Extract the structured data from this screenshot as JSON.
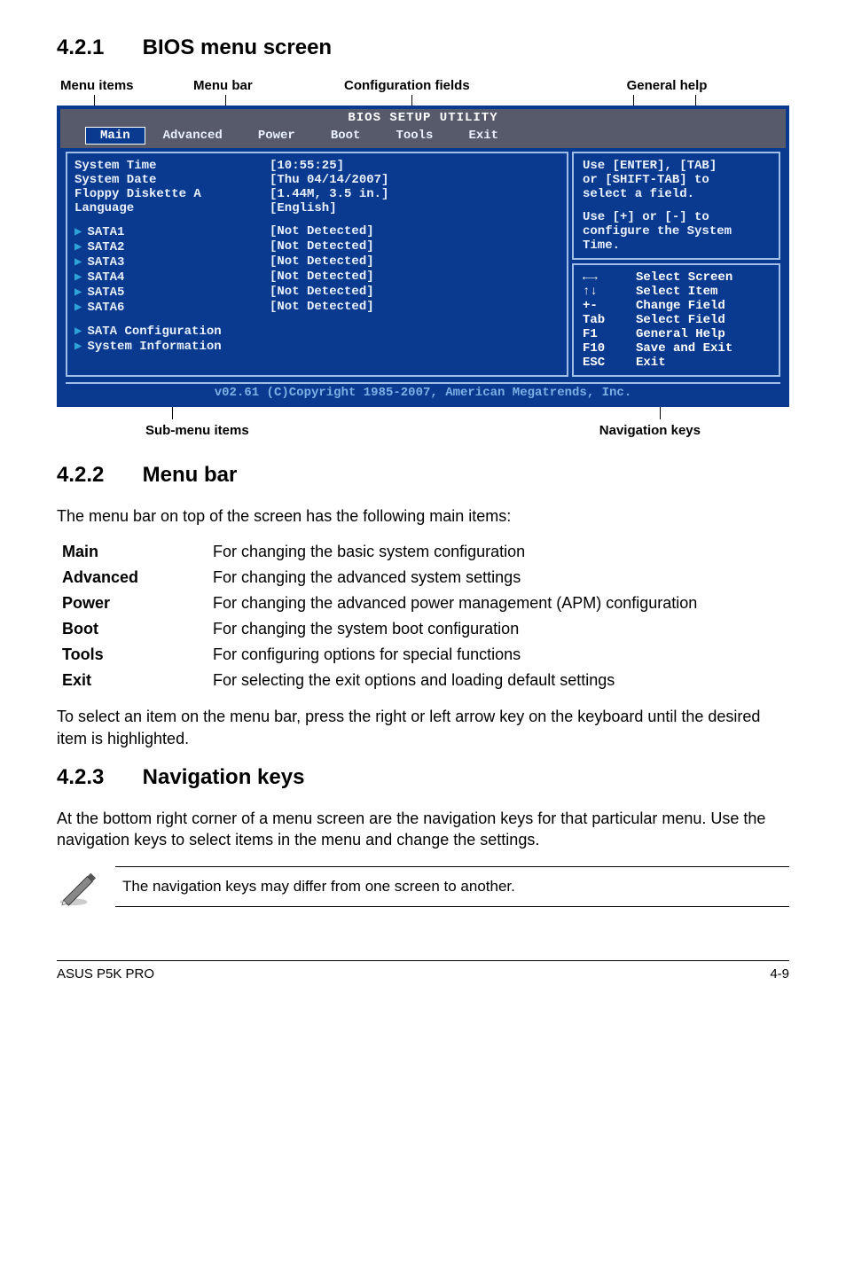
{
  "sections": {
    "s1": {
      "num": "4.2.1",
      "title": "BIOS menu screen"
    },
    "s2": {
      "num": "4.2.2",
      "title": "Menu bar"
    },
    "s3": {
      "num": "4.2.3",
      "title": "Navigation keys"
    }
  },
  "callouts": {
    "menu_items": "Menu items",
    "menu_bar": "Menu bar",
    "config_fields": "Configuration fields",
    "general_help": "General help",
    "sub_menu": "Sub-menu items",
    "nav_keys": "Navigation keys"
  },
  "bios": {
    "title": "BIOS SETUP UTILITY",
    "menubar": [
      "Main",
      "Advanced",
      "Power",
      "Boot",
      "Tools",
      "Exit"
    ],
    "rows": [
      {
        "label": "System Time",
        "value": "[10:55:25]"
      },
      {
        "label": "System Date",
        "value": "[Thu 04/14/2007]"
      },
      {
        "label": "Floppy Diskette A",
        "value": "[1.44M, 3.5 in.]"
      },
      {
        "label": "Language",
        "value": "[English]"
      }
    ],
    "sata": [
      {
        "label": "SATA1",
        "value": "[Not Detected]"
      },
      {
        "label": "SATA2",
        "value": "[Not Detected]"
      },
      {
        "label": "SATA3",
        "value": "[Not Detected]"
      },
      {
        "label": "SATA4",
        "value": "[Not Detected]"
      },
      {
        "label": "SATA5",
        "value": "[Not Detected]"
      },
      {
        "label": "SATA6",
        "value": "[Not Detected]"
      }
    ],
    "sub_items": [
      "SATA Configuration",
      "System Information"
    ],
    "help": {
      "l1": "Use [ENTER], [TAB]",
      "l2": "or [SHIFT-TAB] to",
      "l3": "select a field.",
      "l4": "Use [+] or [-] to",
      "l5": "configure the System",
      "l6": "Time."
    },
    "keys": [
      {
        "k": "←→",
        "d": "Select Screen"
      },
      {
        "k": "↑↓",
        "d": "Select Item"
      },
      {
        "k": "+-",
        "d": "Change Field"
      },
      {
        "k": "Tab",
        "d": "Select Field"
      },
      {
        "k": "F1",
        "d": "General Help"
      },
      {
        "k": "F10",
        "d": "Save and Exit"
      },
      {
        "k": "ESC",
        "d": "Exit"
      }
    ],
    "footer": "v02.61 (C)Copyright 1985-2007, American Megatrends, Inc."
  },
  "menu_bar_intro": "The menu bar on top of the screen has the following main items:",
  "menu_bar_table": [
    {
      "term": "Main",
      "desc": "For changing the basic system configuration"
    },
    {
      "term": "Advanced",
      "desc": "For changing the advanced system settings"
    },
    {
      "term": "Power",
      "desc": "For changing the advanced power management (APM) configuration"
    },
    {
      "term": "Boot",
      "desc": "For changing the system boot configuration"
    },
    {
      "term": "Tools",
      "desc": "For configuring options for special functions"
    },
    {
      "term": "Exit",
      "desc": "For selecting the exit options and loading default settings"
    }
  ],
  "menu_bar_outro": "To select an item on the menu bar, press the right or left arrow key on the keyboard until the desired item is highlighted.",
  "nav_keys_text": "At the bottom right corner of a menu screen are the navigation keys for that particular menu. Use the navigation keys to select items in the menu and change the settings.",
  "note_text": "The navigation keys may differ from one screen to another.",
  "footer": {
    "left": "ASUS P5K PRO",
    "right": "4-9"
  }
}
